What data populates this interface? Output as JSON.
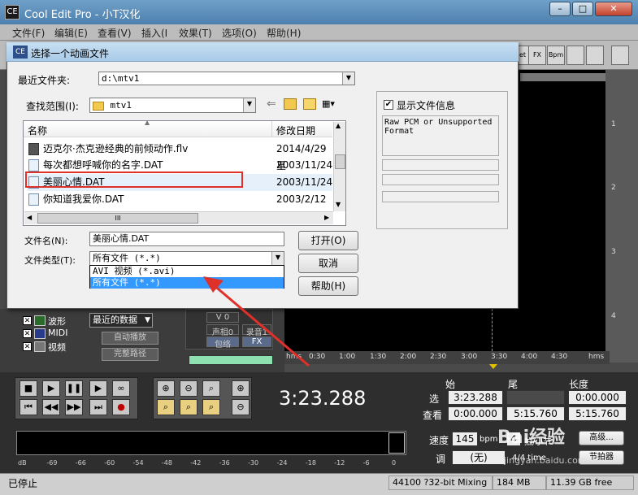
{
  "window": {
    "title": "Cool Edit Pro  - 小T汉化",
    "app_icon": "cool-edit-icon",
    "min_label": "–",
    "max_label": "□",
    "close_label": "✕"
  },
  "menu": [
    "文件(F)",
    "编辑(E)",
    "查看(V)",
    "插入(I",
    "效果(T)",
    "选项(O)",
    "帮助(H)"
  ],
  "toolbar": {
    "buttons": [
      "et",
      "FX",
      "Bpm",
      "",
      "",
      ""
    ]
  },
  "dialog": {
    "title": "选择一个动画文件",
    "recent_label": "最近文件夹:",
    "recent_value": "d:\\mtv1",
    "lookin_label": "查找范围(I):",
    "lookin_value": "mtv1",
    "col_name": "名称",
    "col_date": "修改日期",
    "files": [
      {
        "name": "迈克尔·杰克逊经典的前倾动作.flv",
        "date": "2014/4/29 星"
      },
      {
        "name": "每次都想呼喊你的名字.DAT",
        "date": "2003/11/24"
      },
      {
        "name": "美丽心情.DAT",
        "date": "2003/11/24"
      },
      {
        "name": "你知道我爱你.DAT",
        "date": "2003/2/12 星"
      }
    ],
    "hscroll_grip": "III",
    "filename_label": "文件名(N):",
    "filename_value": "美丽心情.DAT",
    "filetype_label": "文件类型(T):",
    "filetype_value": "所有文件  (*.*)",
    "filetype_options": [
      "AVI 视频  (*.avi)",
      "所有文件  (*.*)"
    ],
    "open_button": "打开(O)",
    "cancel_button": "取消",
    "help_button": "帮助(H)",
    "show_info_label": "显示文件信息",
    "show_info_checked": true,
    "info_text": "Raw PCM or Unsupported Format"
  },
  "organizer": {
    "items": [
      {
        "label": "波形",
        "checked": true
      },
      {
        "label": "MIDI",
        "checked": true
      },
      {
        "label": "视频",
        "checked": true
      }
    ],
    "recent_dropdown": "最近的数据",
    "autoplay_button": "自动播放",
    "fullpath_button": "完整路径",
    "v_label": "V 0",
    "channel_label": "声相0",
    "record_label": "录音1",
    "fx_label": "FX",
    "env_label": "包络"
  },
  "timeline": {
    "unit": "hms",
    "ticks": [
      "0:30",
      "1:00",
      "1:30",
      "2:00",
      "2:30",
      "3:00",
      "3:30",
      "4:00",
      "4:30"
    ],
    "track_numbers": [
      "1",
      "2",
      "3",
      "4"
    ]
  },
  "transport": {
    "current_time": "3:23.288",
    "begin_label": "始",
    "end_label": "尾",
    "length_label": "长度",
    "select_label": "选",
    "view_label": "查看",
    "sel_begin": "3:23.288",
    "sel_end": "",
    "sel_length": "0:00.000",
    "view_begin": "0:00.000",
    "view_end": "5:15.760",
    "view_length": "5:15.760"
  },
  "levels": {
    "scale": [
      "dB",
      "-69",
      "-66",
      "-60",
      "-54",
      "-48",
      "-42",
      "-36",
      "-30",
      "-24",
      "-18",
      "-12",
      "-6",
      "0"
    ]
  },
  "speed": {
    "speed_label": "速度",
    "speed_value": "145",
    "bpm_label": "bpm",
    "beats_value": "4",
    "beats_label": "拍/小节",
    "key_label": "调",
    "key_value": "(无)",
    "advanced_button": "高级...",
    "meter_label": "4/4 time",
    "metronome_button": "节拍器"
  },
  "status": {
    "state": "已停止",
    "format": "44100 ?32-bit Mixing",
    "mem": "184 MB",
    "disk": "11.39 GB free"
  },
  "annotation": {
    "highlight_color": "#e0302a",
    "arrow_color": "#e0302a"
  },
  "watermark": {
    "text": "Bai经验",
    "sub": "jingyan.baidu.com"
  }
}
